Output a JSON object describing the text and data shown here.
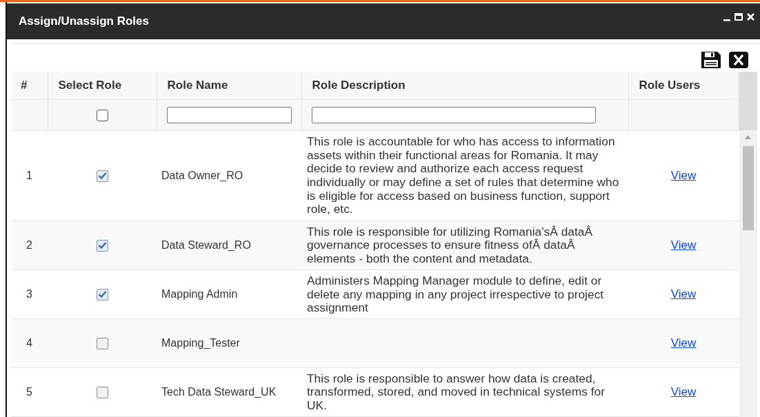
{
  "window": {
    "title": "Assign/Unassign Roles"
  },
  "table": {
    "columns": [
      "#",
      "Select Role",
      "Role Name",
      "Role Description",
      "Role Users"
    ],
    "filters": {
      "select_all": {
        "checked": false
      }
    },
    "rows": [
      {
        "number": "1",
        "checked": true,
        "name": "Data Owner_RO",
        "description": "This role is accountable for who has access to information assets within their functional areas for Romania. It may decide to review and authorize each access request individually or may define a set of rules that determine who is eligible for access based on business function, support role, etc.",
        "users": "View"
      },
      {
        "number": "2",
        "checked": true,
        "name": "Data Steward_RO",
        "description": "This role is responsible for utilizing Romania'sÂ dataÂ governance processes to ensure fitness ofÂ dataÂ elements - both the content and metadata.",
        "users": "View"
      },
      {
        "number": "3",
        "checked": true,
        "name": "Mapping Admin",
        "description": "Administers Mapping Manager module to define, edit or delete any mapping in any project irrespective to project assignment",
        "users": "View"
      },
      {
        "number": "4",
        "checked": false,
        "name": "Mapping_Tester",
        "users": "View"
      },
      {
        "number": "5",
        "checked": false,
        "name": "Tech Data Steward_UK",
        "description": "This role is responsible to answer how data is created, transformed, stored, and moved in technical systems for UK.",
        "users": "View"
      }
    ]
  }
}
